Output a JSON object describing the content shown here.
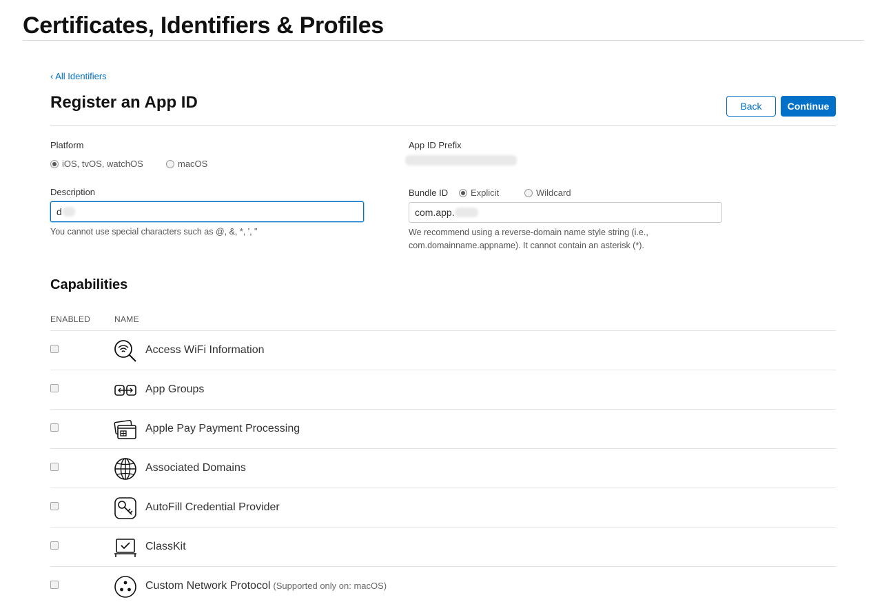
{
  "header": {
    "title": "Certificates, Identifiers & Profiles"
  },
  "nav": {
    "back_link": "‹ All Identifiers"
  },
  "section": {
    "title": "Register an App ID",
    "back_button": "Back",
    "continue_button": "Continue"
  },
  "platform": {
    "label": "Platform",
    "options": [
      {
        "label": "iOS, tvOS, watchOS",
        "checked": true
      },
      {
        "label": "macOS",
        "checked": false
      }
    ]
  },
  "app_id_prefix": {
    "label": "App ID Prefix"
  },
  "description": {
    "label": "Description",
    "value": "d",
    "help": "You cannot use special characters such as @, &, *, ', \""
  },
  "bundle_id": {
    "label": "Bundle ID",
    "options": [
      {
        "label": "Explicit",
        "checked": true
      },
      {
        "label": "Wildcard",
        "checked": false
      }
    ],
    "value": "com.app.",
    "help_line1": "We recommend using a reverse-domain name style string (i.e.,",
    "help_line2": "com.domainname.appname). It cannot contain an asterisk (*)."
  },
  "capabilities": {
    "title": "Capabilities",
    "col_enabled": "ENABLED",
    "col_name": "NAME",
    "items": [
      {
        "name": "Access WiFi Information",
        "note": "",
        "icon": "wifi-search-icon",
        "enabled": false
      },
      {
        "name": "App Groups",
        "note": "",
        "icon": "app-groups-icon",
        "enabled": false
      },
      {
        "name": "Apple Pay Payment Processing",
        "note": "",
        "icon": "apple-pay-card-icon",
        "enabled": false
      },
      {
        "name": "Associated Domains",
        "note": "",
        "icon": "globe-icon",
        "enabled": false
      },
      {
        "name": "AutoFill Credential Provider",
        "note": "",
        "icon": "key-icon",
        "enabled": false
      },
      {
        "name": "ClassKit",
        "note": "",
        "icon": "classkit-icon",
        "enabled": false
      },
      {
        "name": "Custom Network Protocol",
        "note": "(Supported only on: macOS)",
        "icon": "network-protocol-icon",
        "enabled": false
      }
    ]
  }
}
